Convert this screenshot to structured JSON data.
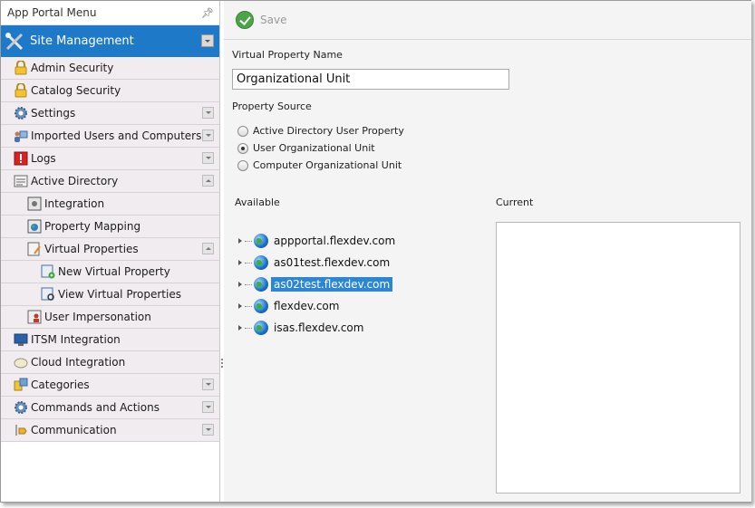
{
  "sidebar": {
    "title": "App Portal Menu",
    "section": "Site Management",
    "items": [
      {
        "label": "Admin Security",
        "icon": "lock-icon",
        "level": 1
      },
      {
        "label": "Catalog Security",
        "icon": "lock-icon",
        "level": 1
      },
      {
        "label": "Settings",
        "icon": "gear-icon",
        "level": 1,
        "expander": "down"
      },
      {
        "label": "Imported Users and Computers",
        "icon": "users-computer-icon",
        "level": 1,
        "expander": "down"
      },
      {
        "label": "Logs",
        "icon": "log-alert-icon",
        "level": 1,
        "expander": "down"
      },
      {
        "label": "Active Directory",
        "icon": "directory-icon",
        "level": 1,
        "expander": "up"
      },
      {
        "label": "Integration",
        "icon": "integration-icon",
        "level": 2
      },
      {
        "label": "Property Mapping",
        "icon": "property-mapping-icon",
        "level": 2
      },
      {
        "label": "Virtual Properties",
        "icon": "virtual-properties-icon",
        "level": 2,
        "expander": "up"
      },
      {
        "label": "New Virtual Property",
        "icon": "new-property-icon",
        "level": 3
      },
      {
        "label": "View Virtual Properties",
        "icon": "view-properties-icon",
        "level": 3
      },
      {
        "label": "User Impersonation",
        "icon": "impersonation-icon",
        "level": 2
      },
      {
        "label": "ITSM Integration",
        "icon": "itsm-icon",
        "level": 1
      },
      {
        "label": "Cloud Integration",
        "icon": "cloud-icon",
        "level": 1
      },
      {
        "label": "Categories",
        "icon": "categories-icon",
        "level": 1,
        "expander": "down"
      },
      {
        "label": "Commands and Actions",
        "icon": "gear-icon",
        "level": 1,
        "expander": "down"
      },
      {
        "label": "Communication",
        "icon": "communication-icon",
        "level": 1,
        "expander": "down"
      }
    ]
  },
  "toolbar": {
    "save_label": "Save"
  },
  "form": {
    "name_label": "Virtual Property Name",
    "name_value": "Organizational Unit",
    "source_label": "Property Source",
    "source_options": [
      {
        "label": "Active Directory User Property",
        "selected": false
      },
      {
        "label": "User Organizational Unit",
        "selected": true
      },
      {
        "label": "Computer Organizational Unit",
        "selected": false
      }
    ],
    "available_label": "Available",
    "current_label": "Current",
    "domains": [
      {
        "label": "appportal.flexdev.com",
        "selected": false
      },
      {
        "label": "as01test.flexdev.com",
        "selected": false
      },
      {
        "label": "as02test.flexdev.com",
        "selected": true
      },
      {
        "label": "flexdev.com",
        "selected": false
      },
      {
        "label": "isas.flexdev.com",
        "selected": false
      }
    ]
  },
  "colors": {
    "section_header": "#1e79c9",
    "selected_node": "#2b87d3",
    "save_icon": "#4da447"
  }
}
